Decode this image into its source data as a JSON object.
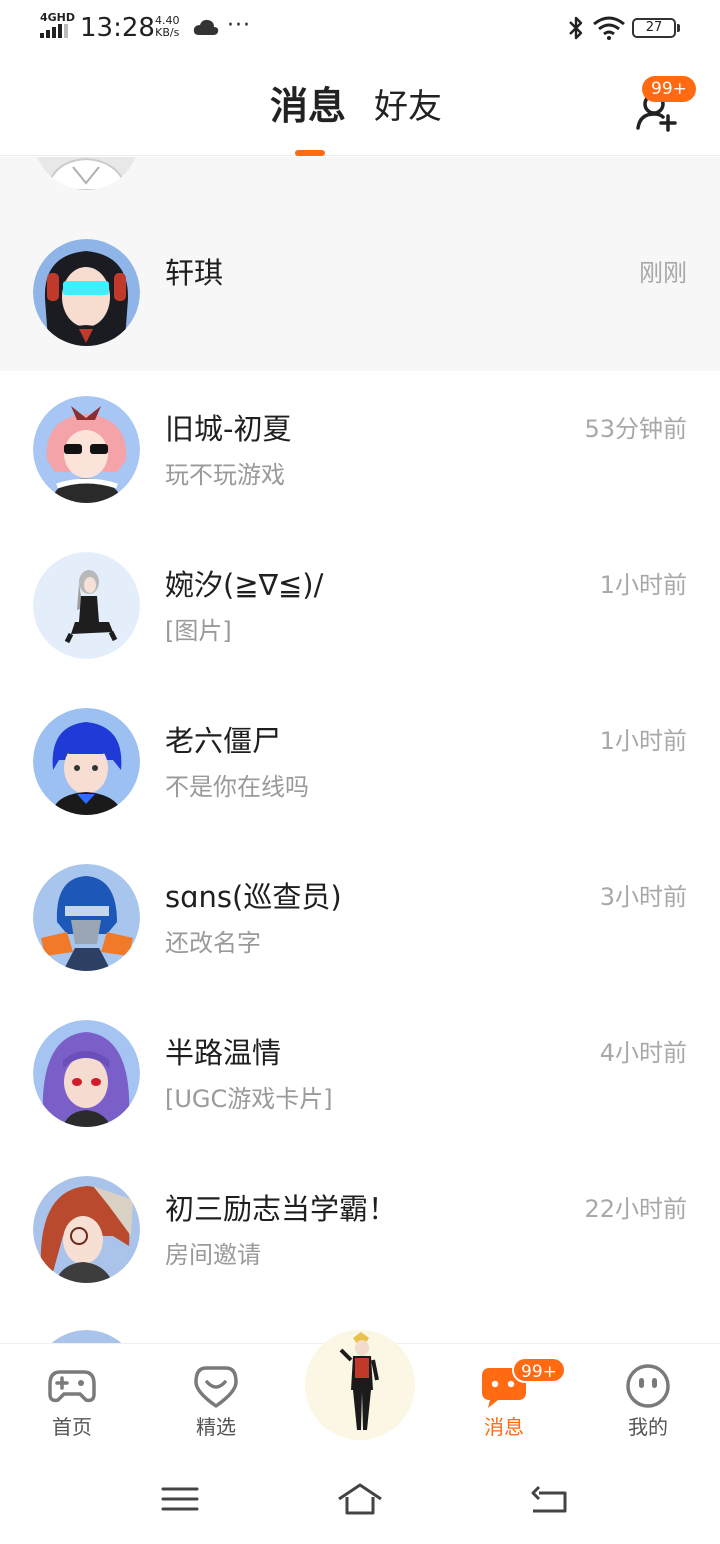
{
  "status_bar": {
    "network": "4GHD",
    "time": "13:28",
    "speed_value": "4.40",
    "speed_unit": "KB/s",
    "more": "···",
    "battery": "27"
  },
  "header": {
    "tabs": [
      {
        "label": "消息",
        "active": true
      },
      {
        "label": "好友",
        "active": false
      }
    ],
    "add_friend_badge": "99+"
  },
  "conversations": [
    {
      "name": "轩琪",
      "preview": "",
      "time": "刚刚",
      "pinned": true,
      "avatar": "avatar-vr-headset-girl"
    },
    {
      "name": "旧城-初夏",
      "preview": "玩不玩游戏",
      "time": "53分钟前",
      "pinned": false,
      "avatar": "avatar-pink-hair-girl"
    },
    {
      "name": "婉汐(≧∇≦)/",
      "preview": "[图片]",
      "time": "1小时前",
      "pinned": false,
      "avatar": "avatar-silver-hair-sitting"
    },
    {
      "name": "老六僵尸",
      "preview": "不是你在线吗",
      "time": "1小时前",
      "pinned": false,
      "avatar": "avatar-blue-hair-boy"
    },
    {
      "name": "sɑns(巡查员)",
      "preview": "还改名字",
      "time": "3小时前",
      "pinned": false,
      "avatar": "avatar-robot-helmet"
    },
    {
      "name": "半路温情",
      "preview": "[UGC游戏卡片]",
      "time": "4小时前",
      "pinned": false,
      "avatar": "avatar-purple-hair-girl"
    },
    {
      "name": "初三励志当学霸！",
      "preview": "房间邀请",
      "time": "22小时前",
      "pinned": false,
      "avatar": "avatar-auburn-hair-girl"
    }
  ],
  "bottom_nav": {
    "items": [
      {
        "label": "首页",
        "icon": "gamepad-icon",
        "active": false
      },
      {
        "label": "精选",
        "icon": "heart-chat-icon",
        "active": false
      },
      {
        "label": "消息",
        "icon": "message-icon",
        "active": true
      },
      {
        "label": "我的",
        "icon": "face-icon",
        "active": false
      }
    ],
    "message_badge": "99+"
  },
  "colors": {
    "accent": "#ff6a13",
    "pinned_bg": "#f7f7f7",
    "secondary_text": "#9a9a9a"
  }
}
